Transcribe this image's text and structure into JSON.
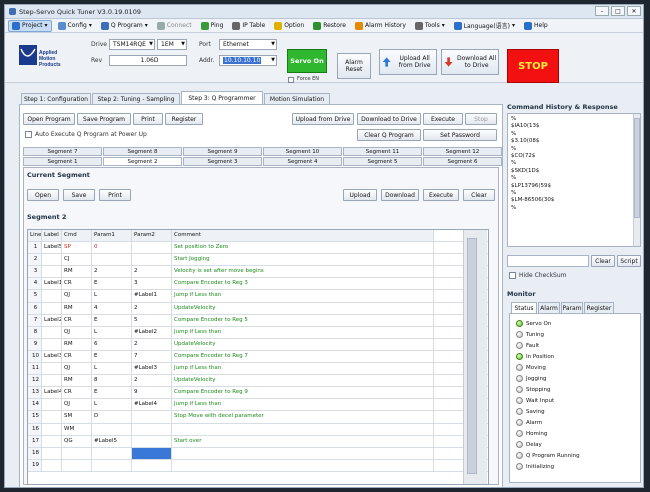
{
  "window": {
    "title": "Step-Servo Quick Tuner V3.0.19.0109",
    "controls": [
      "–",
      "□",
      "✕"
    ]
  },
  "menu": [
    {
      "label": "Project",
      "icon": "project-icon",
      "color": "#2a6fc9",
      "selected": true
    },
    {
      "label": "Config",
      "icon": "config-icon",
      "color": "#5a8ad0"
    },
    {
      "label": "Q Program",
      "icon": "q-program-icon",
      "color": "#3b6fb8"
    },
    {
      "label": "Connect",
      "icon": "connect-icon",
      "color": "#9aa",
      "disabled": true
    },
    {
      "label": "Ping",
      "icon": "ping-icon",
      "color": "#3a9a3a"
    },
    {
      "label": "IP Table",
      "icon": "ip-table-icon",
      "color": "#666"
    },
    {
      "label": "Option",
      "icon": "option-icon",
      "color": "#e0b000"
    },
    {
      "label": "Restore",
      "icon": "restore-icon",
      "color": "#2d8f2d"
    },
    {
      "label": "Alarm History",
      "icon": "alarm-icon",
      "color": "#e38a00"
    },
    {
      "label": "Tools",
      "icon": "tools-icon",
      "color": "#666"
    },
    {
      "label": "Language(语言)",
      "icon": "globe-icon",
      "color": "#2a6fc9"
    },
    {
      "label": "Help",
      "icon": "help-icon",
      "color": "#2a6fc9"
    }
  ],
  "header": {
    "logo_text": "Applied Motion Products",
    "drive_label": "Drive",
    "drive_value": "TSM14RQE",
    "drive_value2": "1EM",
    "rev_label": "Rev",
    "rev_value": "1.06D",
    "port_label": "Port",
    "port_value": "Ethernet",
    "addr_label": "Addr.",
    "addr_value": "10.10.10.10",
    "force_label": "Force EN",
    "servo_on": "Servo On",
    "alarm_reset": "Alarm Reset",
    "upload_all": "Upload All from Drive",
    "download_all": "Download All to Drive",
    "stop": "STOP"
  },
  "steps": {
    "tabs": [
      "Step 1: Configuration",
      "Step 2: Tuning - Sampling",
      "Step 3: Q Programmer",
      "Motion Simulation"
    ]
  },
  "toolbar": {
    "open": "Open Program",
    "save": "Save Program",
    "print": "Print",
    "register": "Register",
    "upload": "Upload from Drive",
    "download": "Download to Drive",
    "execute": "Execute",
    "stop": "Stop",
    "auto_exec": "Auto Execute Q Program at Power Up",
    "clear": "Clear Q Program",
    "password": "Set Password"
  },
  "segments": {
    "row1": [
      "Segment 7",
      "Segment 8",
      "Segment 9",
      "Segment 10",
      "Segment 11",
      "Segment 12"
    ],
    "row2": [
      "Segment 1",
      "Segment 2",
      "Segment 3",
      "Segment 4",
      "Segment 5",
      "Segment 6"
    ]
  },
  "current": {
    "title": "Current Segment",
    "open": "Open",
    "save": "Save",
    "print": "Print",
    "upload": "Upload",
    "download": "Download",
    "execute": "Execute",
    "clear": "Clear"
  },
  "grid": {
    "title": "Segment 2",
    "columns": [
      "Line",
      "Label",
      "Cmd",
      "Param1",
      "Param2",
      "Comment"
    ],
    "rows": [
      [
        "1",
        "Label5",
        "SP",
        "0",
        "",
        "Set position to Zero"
      ],
      [
        "2",
        "",
        "CJ",
        "",
        "",
        "Start Jogging"
      ],
      [
        "3",
        "",
        "RM",
        "2",
        "2",
        "Velocity is set after move begins"
      ],
      [
        "4",
        "Label1",
        "CR",
        "E",
        "3",
        "Compare Encoder to Reg 3"
      ],
      [
        "5",
        "",
        "QJ",
        "L",
        "#Label1",
        "Jump if Less than"
      ],
      [
        "6",
        "",
        "RM",
        "4",
        "2",
        "UpdateVelocity"
      ],
      [
        "7",
        "Label2",
        "CR",
        "E",
        "5",
        "Compare Encoder to Reg 5"
      ],
      [
        "8",
        "",
        "QJ",
        "L",
        "#Label2",
        "Jump if Less than"
      ],
      [
        "9",
        "",
        "RM",
        "6",
        "2",
        "UpdateVelocity"
      ],
      [
        "10",
        "Label3",
        "CR",
        "E",
        "7",
        "Compare Encoder to Reg 7"
      ],
      [
        "11",
        "",
        "QJ",
        "L",
        "#Label3",
        "Jump if Less than"
      ],
      [
        "12",
        "",
        "RM",
        "8",
        "2",
        "UpdateVelocity"
      ],
      [
        "13",
        "Label4",
        "CR",
        "E",
        "9",
        "Compare Encoder to Reg 9"
      ],
      [
        "14",
        "",
        "QJ",
        "L",
        "#Label4",
        "Jump if Less than"
      ],
      [
        "15",
        "",
        "SM",
        "D",
        "",
        "Stop Move with decel parameter"
      ],
      [
        "16",
        "",
        "WM",
        "",
        "",
        ""
      ],
      [
        "17",
        "",
        "QG",
        "#Label5",
        "",
        "Start over"
      ],
      [
        "18",
        "",
        "",
        "",
        "",
        ""
      ],
      [
        "19",
        "",
        "",
        "",
        "",
        ""
      ]
    ]
  },
  "history": {
    "title": "Command History & Response",
    "lines": [
      "%",
      "$IA10(13$",
      "%",
      "$3.10(08$",
      "%",
      "$CO(72$",
      "%",
      "$SKD(1D$",
      "%",
      "$LP13796(59$",
      "%",
      "$LM-86506(30$",
      "%"
    ],
    "clear": "Clear",
    "script": "Script",
    "hide_checksum": "Hide CheckSum"
  },
  "monitor": {
    "title": "Monitor",
    "tabs": [
      "Status",
      "Alarm",
      "Param",
      "Register"
    ],
    "items": [
      {
        "label": "Servo On",
        "on": true
      },
      {
        "label": "Tuning",
        "on": false
      },
      {
        "label": "Fault",
        "on": false
      },
      {
        "label": "In Position",
        "on": true
      },
      {
        "label": "Moving",
        "on": false
      },
      {
        "label": "Jogging",
        "on": false
      },
      {
        "label": "Stopping",
        "on": false
      },
      {
        "label": "Wait Input",
        "on": false
      },
      {
        "label": "Saving",
        "on": false
      },
      {
        "label": "Alarm",
        "on": false
      },
      {
        "label": "Homing",
        "on": false
      },
      {
        "label": "Delay",
        "on": false
      },
      {
        "label": "Q Program Running",
        "on": false
      },
      {
        "label": "Initializing",
        "on": false
      }
    ]
  }
}
